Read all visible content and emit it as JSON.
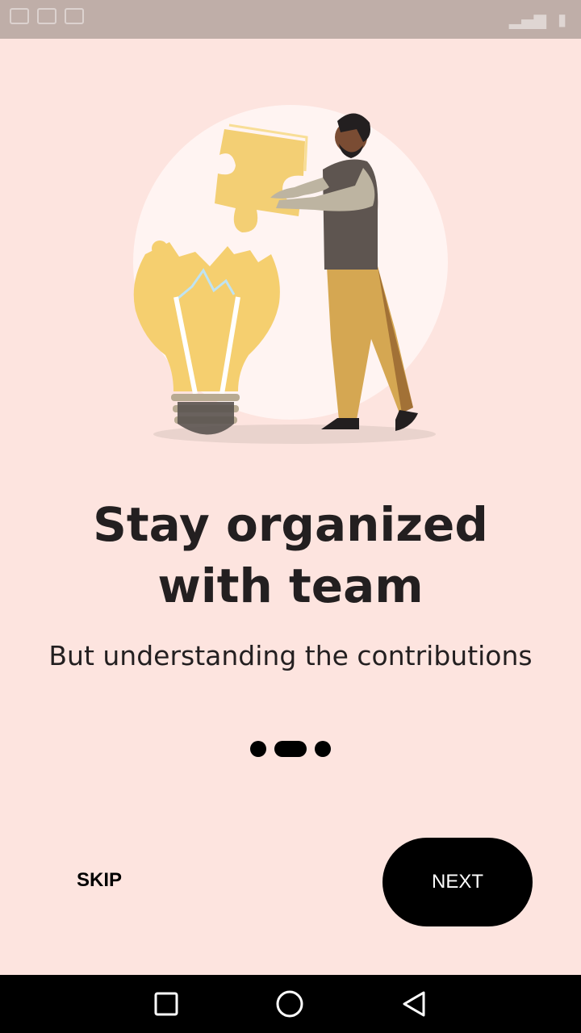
{
  "onboarding": {
    "title_line1": "Stay organized",
    "title_line2": "with team",
    "subtitle": "But understanding the contributions",
    "page_count": 3,
    "active_page": 2
  },
  "actions": {
    "skip_label": "SKIP",
    "next_label": "NEXT"
  },
  "navigation": {
    "recents": "square-icon",
    "home": "circle-icon",
    "back": "triangle-back-icon"
  },
  "colors": {
    "background": "#fde4df",
    "button": "#000000",
    "bulb": "#f5cf6f"
  }
}
